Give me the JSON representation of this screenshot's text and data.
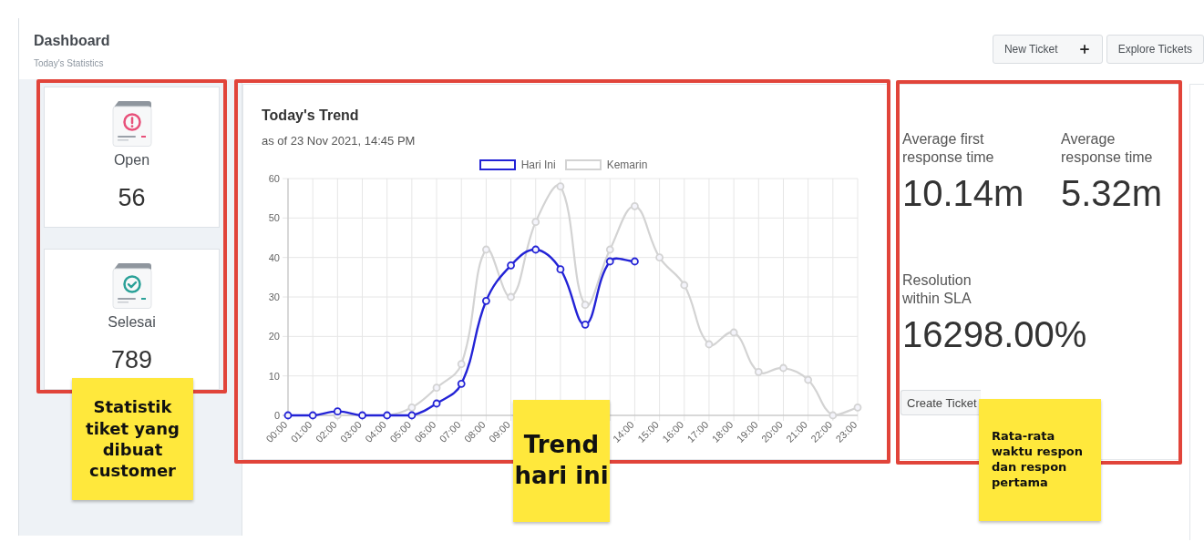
{
  "header": {
    "title": "Dashboard",
    "subtitle": "Today's Statistics",
    "buttons": [
      {
        "label": "New Ticket",
        "kind": "add"
      },
      {
        "label": "Explore Tickets",
        "kind": "plain"
      }
    ]
  },
  "stats": [
    {
      "label": "Open",
      "count": "56",
      "kind": "open"
    },
    {
      "label": "Selesai",
      "count": "789",
      "kind": "done"
    }
  ],
  "trend": {
    "subtitle": "as of 23 Nov 2021, 14:45 PM",
    "chart_data": {
      "type": "line",
      "title": "Today's Trend",
      "legend": "top",
      "grid": true,
      "x": [
        0,
        1,
        2,
        3,
        4,
        5,
        6,
        7,
        8,
        9,
        10,
        11,
        12,
        13,
        14,
        15,
        16,
        17,
        18,
        19,
        20,
        21,
        22,
        23
      ],
      "xlim": [
        0,
        23
      ],
      "xticks": [
        {
          "value": 0,
          "label": "00:00"
        },
        {
          "value": 1,
          "label": "01:00"
        },
        {
          "value": 2,
          "label": "02:00"
        },
        {
          "value": 3,
          "label": "03:00"
        },
        {
          "value": 4,
          "label": "04:00"
        },
        {
          "value": 5,
          "label": "05:00"
        },
        {
          "value": 6,
          "label": "06:00"
        },
        {
          "value": 7,
          "label": "07:00"
        },
        {
          "value": 8,
          "label": "08:00"
        },
        {
          "value": 9,
          "label": "09:00"
        },
        {
          "value": 14,
          "label": "14:00"
        },
        {
          "value": 15,
          "label": "15:00"
        },
        {
          "value": 16,
          "label": "16:00"
        },
        {
          "value": 17,
          "label": "17:00"
        },
        {
          "value": 18,
          "label": "18:00"
        },
        {
          "value": 19,
          "label": "19:00"
        },
        {
          "value": 20,
          "label": "20:00"
        },
        {
          "value": 21,
          "label": "21:00"
        },
        {
          "value": 22,
          "label": "22:00"
        },
        {
          "value": 23,
          "label": "23:00"
        }
      ],
      "ylim": [
        0,
        60
      ],
      "yticks": [
        0,
        10,
        20,
        30,
        40,
        50,
        60
      ],
      "series": [
        {
          "name": "Hari Ini",
          "color": "#2323d6",
          "marker": "circle",
          "values": [
            0,
            0,
            1,
            0,
            0,
            0,
            3,
            8,
            29,
            38,
            42,
            37,
            23,
            39,
            39,
            null,
            null,
            null,
            null,
            null,
            null,
            null,
            null,
            null
          ]
        },
        {
          "name": "Kemarin",
          "color": "#d3d3d3",
          "marker": "circle",
          "values": [
            0,
            0,
            0,
            0,
            0,
            2,
            7,
            13,
            42,
            30,
            49,
            58,
            28,
            42,
            53,
            40,
            33,
            18,
            21,
            11,
            12,
            9,
            0,
            2
          ]
        }
      ]
    }
  },
  "metrics": {
    "items": [
      {
        "label": "Average first response time",
        "value": "10.14m"
      },
      {
        "label": "Average response time",
        "value": "5.32m"
      },
      {
        "label": "Resolution within SLA",
        "value": "16298.00%"
      }
    ],
    "button": {
      "label": "Create Ticket"
    }
  },
  "annotations": [
    {
      "text": "Statistik tiket yang dibuat customer"
    },
    {
      "text": "Trend hari ini"
    },
    {
      "text": "Rata-rata waktu respon dan respon pertama"
    }
  ]
}
